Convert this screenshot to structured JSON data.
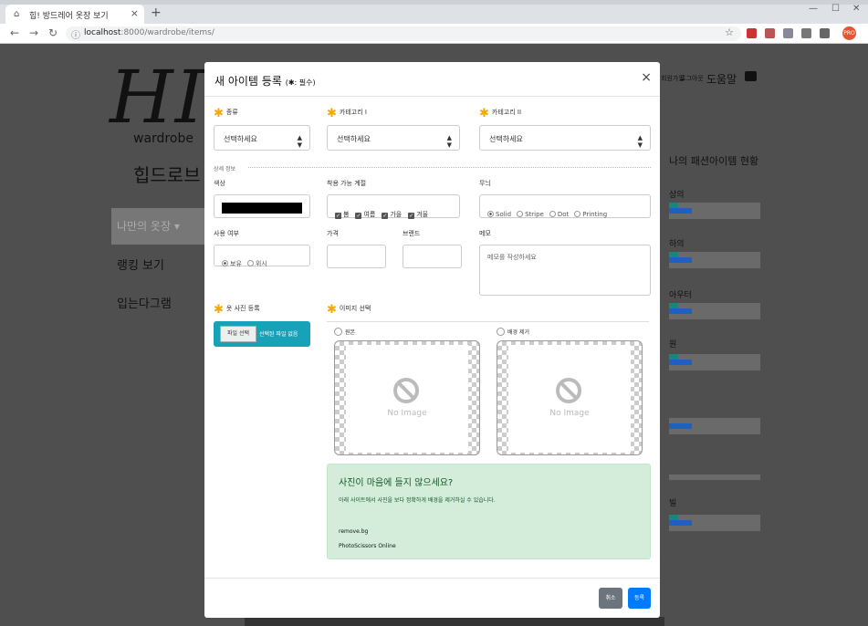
{
  "browser": {
    "tab_title": "힙! 방드레어 옷장 보기",
    "url_host": "localhost",
    "url_rest": ":8000/wardrobe/items/",
    "profile_initials": "PRO"
  },
  "page": {
    "logo_big": "HIP",
    "logo_sub": "wardrobe",
    "logo_kor": "힙드로브",
    "sidebar": [
      "나만의 옷장 ▾",
      "랭킹 보기",
      "입는다그램"
    ],
    "top_right": [
      "회원가입",
      "로그아웃",
      "도움말"
    ],
    "right_title": "나의 패션아이템 현황",
    "right_labels": [
      "상의",
      "하의",
      "아우터",
      "원",
      "",
      "빌"
    ]
  },
  "modal": {
    "title": "새 아이템 등록",
    "title_note": "(✱: 필수)",
    "close": "×",
    "kind_label": "종류",
    "cat1_label": "카테고리 I",
    "cat2_label": "카테고리 II",
    "select_placeholder": "선택하세요",
    "section_label": "상세 정보",
    "color_label": "색상",
    "season_label": "착용 가능 계절",
    "seasons": [
      "봄",
      "여름",
      "가을",
      "겨울"
    ],
    "pattern_label": "무늬",
    "patterns": [
      "Solid",
      "Stripe",
      "Dot",
      "Printing"
    ],
    "owner_label": "사용 여부",
    "owner_opts": [
      "보유",
      "위시"
    ],
    "price_label": "가격",
    "brand_label": "브랜드",
    "memo_label": "메모",
    "memo_placeholder": "메모를 작성하세요",
    "photo_label": "옷 사진 등록",
    "photo_btn": "파일 선택",
    "photo_status": "선택된 파일 없음",
    "preview_label": "이미지 선택",
    "opt_original": "원본",
    "opt_bg_removed": "배경 제거",
    "no_image": "No Image",
    "alert_title": "사진이 마음에 들지 않으세요?",
    "alert_body": "아래 사이트에서 사진을 보다 정확하게 배경을 제거하실 수 있습니다.",
    "alert_link1": "remove.bg",
    "alert_link2": "PhotoScissors Online",
    "cancel_btn": "취소",
    "submit_btn": "등록"
  },
  "colors": {
    "accent": "#f5a800",
    "info": "#17a2b8",
    "primary": "#007bff",
    "secondary": "#6c757d",
    "success_bg": "#d4edda"
  }
}
